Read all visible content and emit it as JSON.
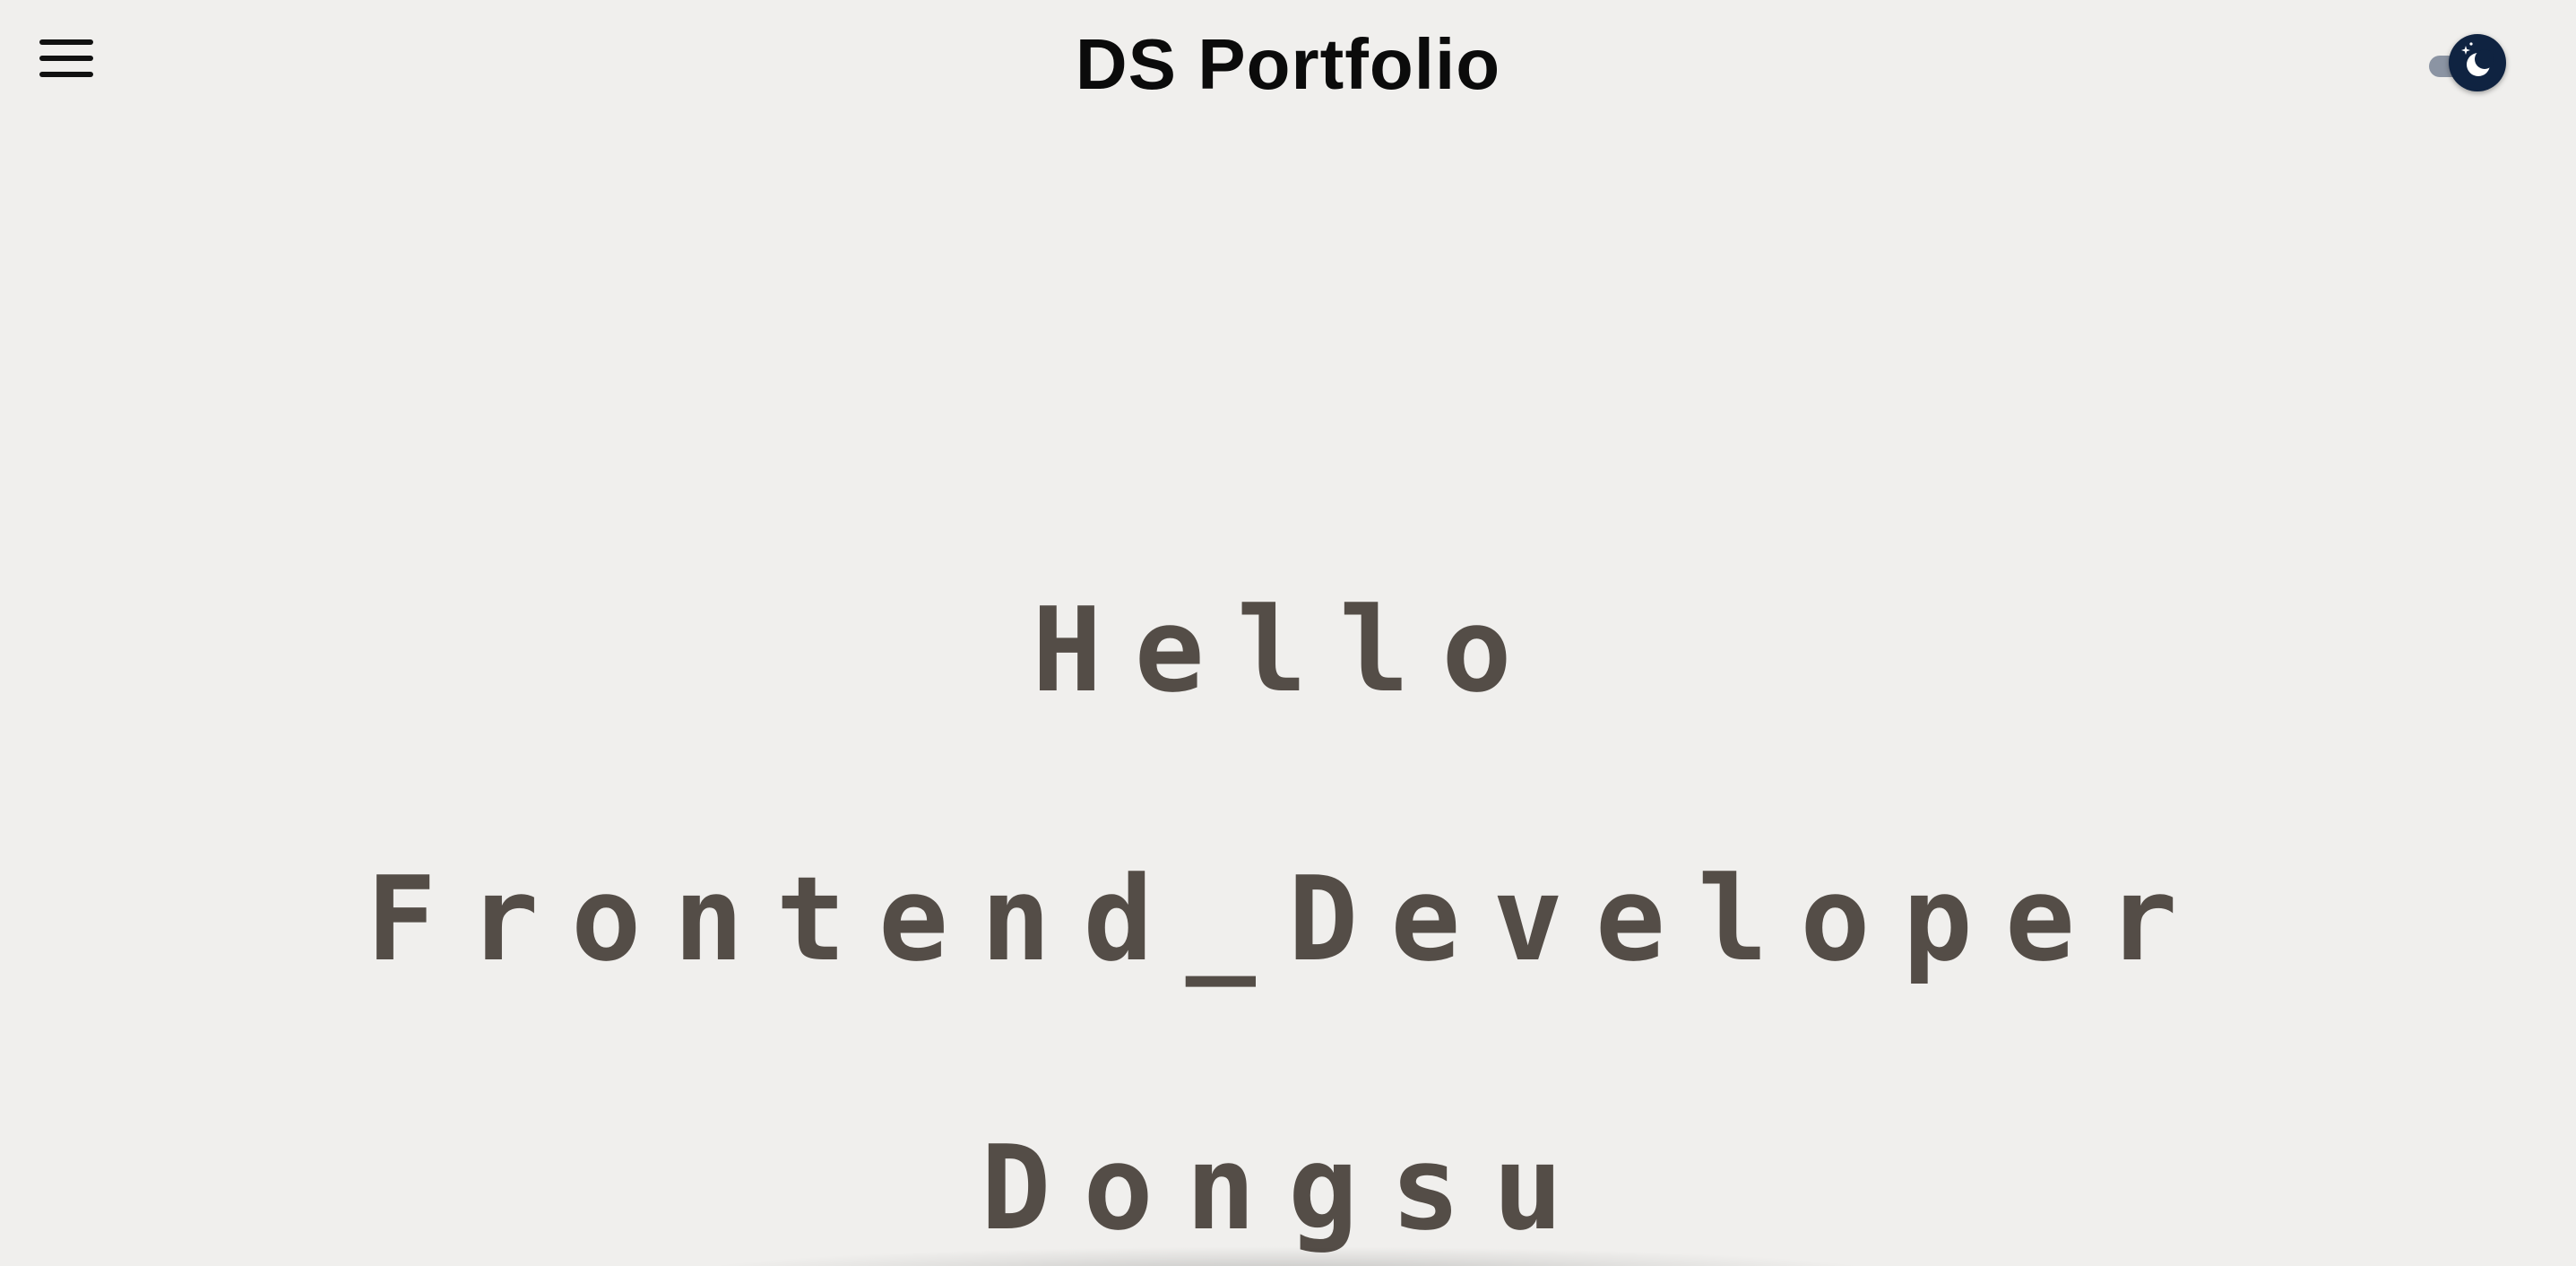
{
  "header": {
    "title": "DS Portfolio",
    "menu_icon": "hamburger-menu-icon",
    "theme_toggle_icon": "moon-icon"
  },
  "hero": {
    "line1": "Hello",
    "line2": "Frontend_Developer",
    "line3": "Dongsu"
  },
  "colors": {
    "background": "#f0efed",
    "hero_text": "#544d47",
    "toggle_knob": "#0f2341",
    "toggle_track": "#8b94a3"
  }
}
